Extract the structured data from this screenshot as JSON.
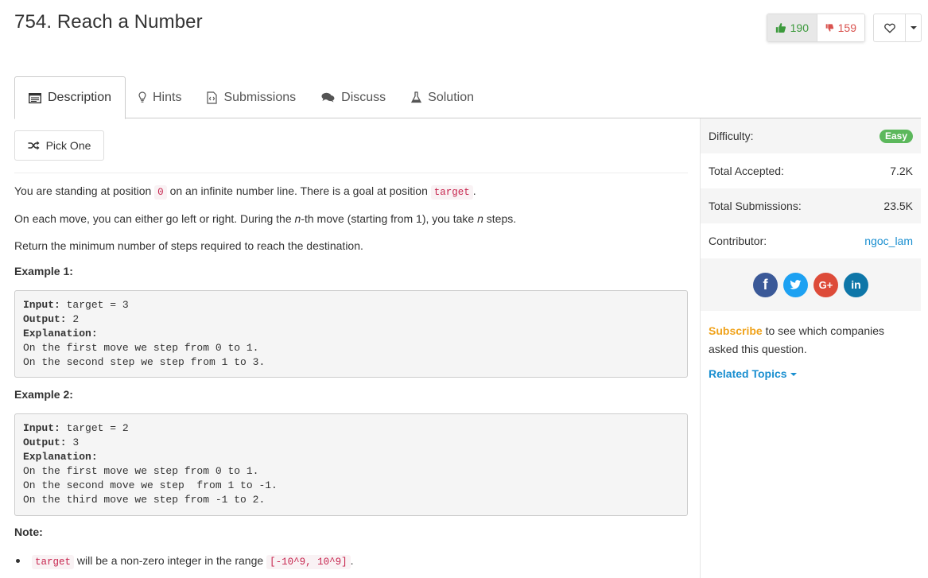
{
  "problem": {
    "title": "754. Reach a Number"
  },
  "votes": {
    "up_count": "190",
    "down_count": "159"
  },
  "tabs": [
    {
      "label": "Description",
      "icon": "description-icon",
      "active": true
    },
    {
      "label": "Hints",
      "icon": "lightbulb-icon"
    },
    {
      "label": "Submissions",
      "icon": "code-file-icon"
    },
    {
      "label": "Discuss",
      "icon": "comments-icon"
    },
    {
      "label": "Solution",
      "icon": "flask-icon"
    }
  ],
  "pick_one": {
    "label": "Pick One",
    "icon": "shuffle-icon"
  },
  "description": {
    "p1_before": "You are standing at position ",
    "p1_code1": "0",
    "p1_middle": " on an infinite number line. There is a goal at position ",
    "p1_code2": "target",
    "p1_after": ".",
    "p2_before": "On each move, you can either go left or right. During the ",
    "p2_em1": "n",
    "p2_middle": "-th move (starting from 1), you take ",
    "p2_em2": "n",
    "p2_after": " steps.",
    "p3": "Return the minimum number of steps required to reach the destination.",
    "example1_heading": "Example 1:",
    "example1": {
      "input_label": "Input:",
      "input_value": " target = 3",
      "output_label": "Output:",
      "output_value": " 2",
      "explanation_label": "Explanation:",
      "lines": [
        "On the first move we step from 0 to 1.",
        "On the second step we step from 1 to 3."
      ]
    },
    "example2_heading": "Example 2:",
    "example2": {
      "input_label": "Input:",
      "input_value": " target = 2",
      "output_label": "Output:",
      "output_value": " 3",
      "explanation_label": "Explanation:",
      "lines": [
        "On the first move we step from 0 to 1.",
        "On the second move we step  from 1 to -1.",
        "On the third move we step from -1 to 2."
      ]
    },
    "note_heading": "Note:",
    "note_code1": "target",
    "note_text": " will be a non-zero integer in the range ",
    "note_code2": "[-10^9, 10^9]",
    "note_after": "."
  },
  "sidebar": {
    "difficulty_label": "Difficulty:",
    "difficulty_value": "Easy",
    "accepted_label": "Total Accepted:",
    "accepted_value": "7.2K",
    "submissions_label": "Total Submissions:",
    "submissions_value": "23.5K",
    "contributor_label": "Contributor:",
    "contributor_value": "ngoc_lam",
    "social": [
      "f",
      "t",
      "G+",
      "in"
    ],
    "subscribe_link": "Subscribe",
    "subscribe_text": " to see which companies asked this question.",
    "related_topics": "Related Topics"
  },
  "colors": {
    "easy_badge": "#5cb85c",
    "link": "#1a8fd0",
    "subscribe": "#f0a31c",
    "upvote": "#3c9a3c",
    "downvote": "#d9534f",
    "code_inline": "#c7254e"
  }
}
